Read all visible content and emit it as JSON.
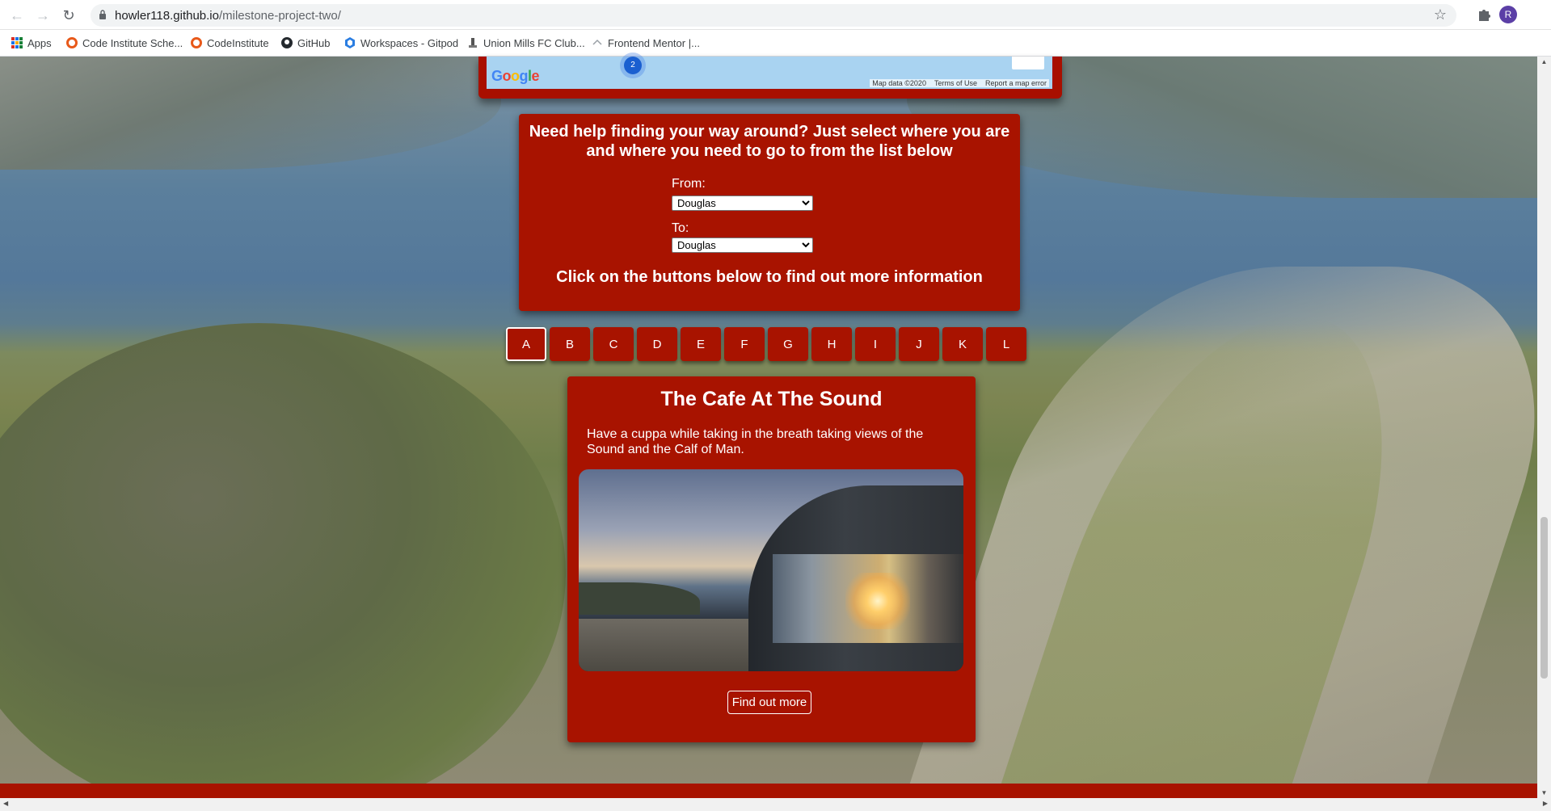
{
  "browser": {
    "url_host": "howler118.github.io",
    "url_path": "/milestone-project-two/",
    "profile_initial": "R",
    "bookmarks": [
      {
        "label": "Apps",
        "icon": "apps-grid-icon"
      },
      {
        "label": "Code Institute Sche...",
        "icon": "code-institute-icon"
      },
      {
        "label": "CodeInstitute",
        "icon": "code-institute-icon"
      },
      {
        "label": "GitHub",
        "icon": "github-icon"
      },
      {
        "label": "Workspaces - Gitpod",
        "icon": "gitpod-icon"
      },
      {
        "label": "Union Mills FC Club...",
        "icon": "club-icon"
      },
      {
        "label": "Frontend Mentor |...",
        "icon": "frontend-mentor-icon"
      }
    ]
  },
  "map": {
    "logo": [
      "G",
      "o",
      "o",
      "g",
      "l",
      "e"
    ],
    "cluster_count": "2",
    "attribution": {
      "data": "Map data ©2020",
      "terms": "Terms of Use",
      "report": "Report a map error"
    }
  },
  "directions": {
    "heading": "Need help finding your way around? Just select where you are and where you need to go to from the list below",
    "from_label": "From:",
    "from_value": "Douglas",
    "to_label": "To:",
    "to_value": "Douglas",
    "info": "Click on the buttons below to find out more information"
  },
  "letters": [
    "A",
    "B",
    "C",
    "D",
    "E",
    "F",
    "G",
    "H",
    "I",
    "J",
    "K",
    "L"
  ],
  "active_letter": "A",
  "card": {
    "title": "The Cafe At The Sound",
    "description": "Have a cuppa while taking in the breath taking views of the Sound and the Calf of Man.",
    "button": "Find out more"
  },
  "colors": {
    "panel_red": "#a81300",
    "accent_profile": "#5b3fa6"
  }
}
